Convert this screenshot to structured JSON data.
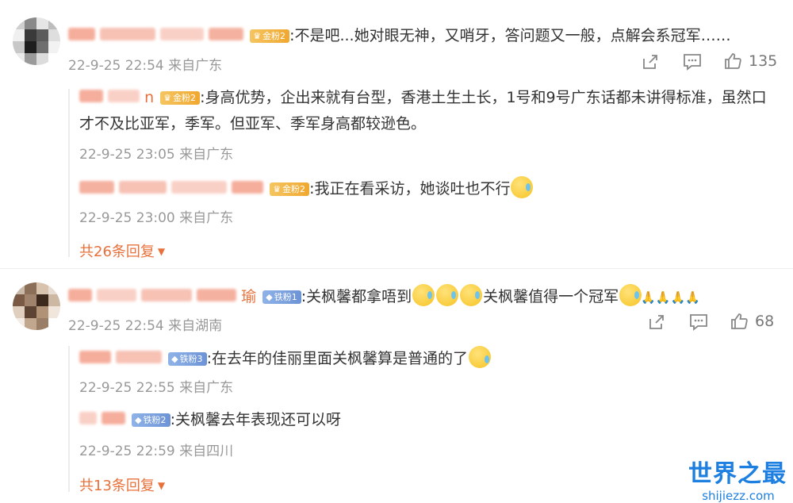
{
  "comments": [
    {
      "badge": "金粉2",
      "text": ":不是吧...她对眼无神，又哨牙，答问题又一般，点解会系冠军……",
      "time": "22-9-25 22:54 来自广东",
      "likes": "135",
      "replies": [
        {
          "name_tail": "n",
          "badge": "金粉2",
          "text_line1": ":身高优势，企出来就有台型，香港土生土长，1号和9号广东话都未讲得标准，虽然口",
          "text_line2": "才不及比亚军，季军。但亚军、季军身高都较逊色。",
          "time": "22-9-25 23:05 来自广东"
        },
        {
          "badge": "金粉2",
          "text": ":我正在看采访，她谈吐也不行",
          "time": "22-9-25 23:00 来自广东"
        }
      ],
      "more_replies": "共26条回复"
    },
    {
      "name_tail": "瑜",
      "badge": "铁粉1",
      "text_a": ":关枫馨都拿唔到",
      "text_b": "关枫馨值得一个冠军",
      "time": "22-9-25 22:54 来自湖南",
      "likes": "68",
      "replies": [
        {
          "badge": "铁粉3",
          "text": ":在去年的佳丽里面关枫馨算是普通的了",
          "time": "22-9-25 22:55 来自广东"
        },
        {
          "badge": "铁粉2",
          "text": ":关枫馨去年表现还可以呀",
          "time": "22-9-25 22:59 来自四川"
        }
      ],
      "more_replies": "共13条回复"
    }
  ],
  "icons": [
    "share-icon",
    "comment-icon",
    "like-icon",
    "chevron-down-icon",
    "sweat-emoji-icon",
    "laugh-cry-emoji-icon",
    "pray-icon"
  ],
  "colors": {
    "accent": "#e8703a",
    "gold_badge": "#f0a830",
    "iron_badge": "#6d93d6",
    "watermark": "#1d7fe0"
  },
  "watermark": {
    "title": "世界之最",
    "url": "shijiezz.com"
  }
}
